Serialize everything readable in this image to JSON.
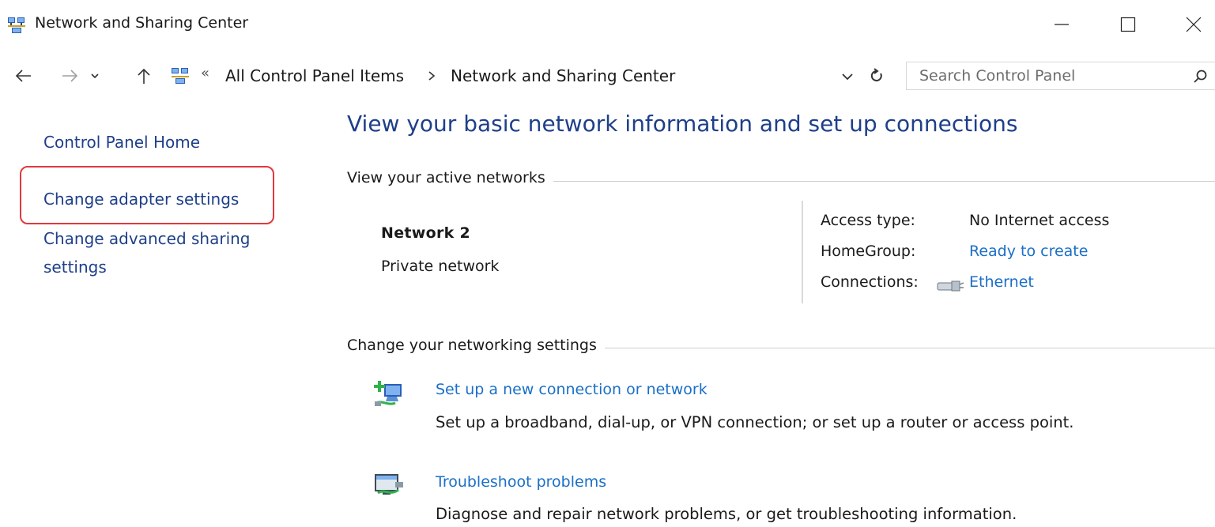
{
  "window": {
    "title": "Network and Sharing Center",
    "icon": "network-sharing-icon",
    "controls": [
      "minimize",
      "maximize",
      "close"
    ]
  },
  "address": {
    "crumbs": [
      "All Control Panel Items",
      "Network and Sharing Center"
    ],
    "overflow_glyph": "«",
    "separator_glyph": "›"
  },
  "search": {
    "placeholder": "Search Control Panel"
  },
  "sidebar": {
    "items": [
      {
        "label": "Control Panel Home"
      },
      {
        "label": "Change adapter settings",
        "highlighted": true
      },
      {
        "label": "Change advanced sharing settings"
      }
    ]
  },
  "main": {
    "heading": "View your basic network information and set up connections",
    "active_section_label": "View your active networks",
    "network": {
      "name": "Network  2",
      "category": "Private network",
      "access_type_label": "Access type:",
      "access_type_value": "No Internet access",
      "homegroup_label": "HomeGroup:",
      "homegroup_value": "Ready to create",
      "connections_label": "Connections:",
      "connections_value": "Ethernet"
    },
    "settings_section_label": "Change your networking settings",
    "tasks": [
      {
        "title": "Set up a new connection or network",
        "desc": "Set up a broadband, dial-up, or VPN connection; or set up a router or access point.",
        "icon": "new-connection-icon"
      },
      {
        "title": "Troubleshoot problems",
        "desc": "Diagnose and repair network problems, or get troubleshooting information.",
        "icon": "troubleshoot-icon"
      }
    ]
  },
  "colors": {
    "link": "#1a6fc7",
    "nav_link": "#1e3f8a",
    "highlight": "#e0393e"
  }
}
